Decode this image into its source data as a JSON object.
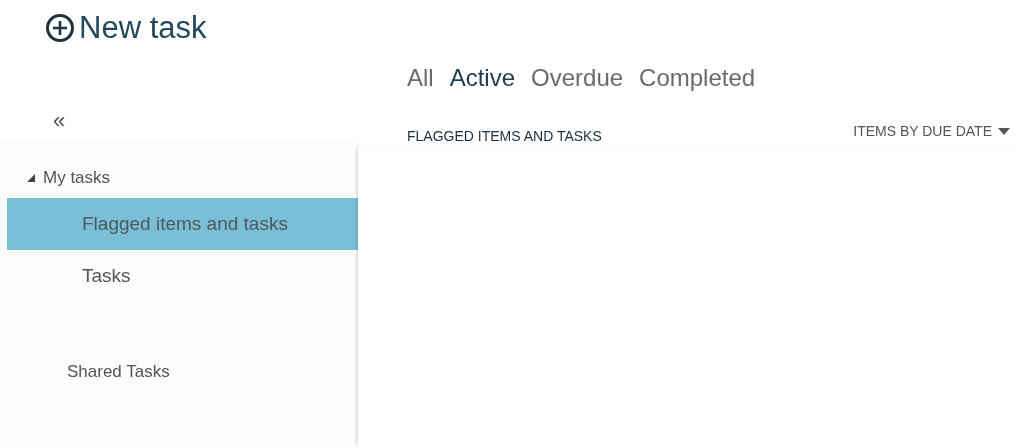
{
  "new_task": {
    "label": "New task"
  },
  "filters": [
    {
      "label": "All",
      "selected": false
    },
    {
      "label": "Active",
      "selected": true
    },
    {
      "label": "Overdue",
      "selected": false
    },
    {
      "label": "Completed",
      "selected": false
    }
  ],
  "collapse_button": {
    "label": "«"
  },
  "list_header": {
    "title": "FLAGGED ITEMS AND TASKS",
    "sort": "ITEMS BY DUE DATE"
  },
  "sidebar": {
    "groups": [
      {
        "label": "My tasks",
        "expanded": true,
        "children": [
          {
            "label": "Flagged items and tasks",
            "selected": true
          },
          {
            "label": "Tasks",
            "selected": false
          }
        ]
      },
      {
        "label": "Shared Tasks",
        "expanded": false
      }
    ]
  }
}
